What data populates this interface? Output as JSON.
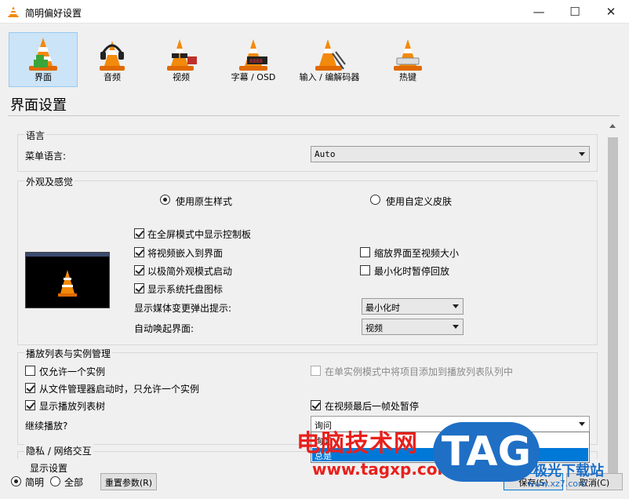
{
  "window": {
    "title": "简明偏好设置",
    "min_glyph": "—",
    "max_glyph": "☐",
    "close_glyph": "✕"
  },
  "categories": [
    {
      "label": "界面",
      "icon": "interface-cone-icon",
      "active": true
    },
    {
      "label": "音频",
      "icon": "audio-headphones-cone-icon",
      "active": false
    },
    {
      "label": "视频",
      "icon": "video-glasses-cone-icon",
      "active": false
    },
    {
      "label": "字幕 / OSD",
      "icon": "subtitle-osd-cone-icon",
      "active": false
    },
    {
      "label": "输入 / 编解码器",
      "icon": "input-codec-cone-icon",
      "active": false
    },
    {
      "label": "热键",
      "icon": "hotkeys-cone-icon",
      "active": false
    }
  ],
  "page_title": "界面设置",
  "language": {
    "group_title": "语言",
    "menu_language_label": "菜单语言:",
    "menu_language_value": "Auto"
  },
  "appearance": {
    "group_title": "外观及感觉",
    "native_style_label": "使用原生样式",
    "custom_skin_label": "使用自定义皮肤",
    "fullscreen_controls_label": "在全屏模式中显示控制板",
    "embed_video_label": "将视频嵌入到界面",
    "minimal_view_label": "以极简外观模式启动",
    "systray_label": "显示系统托盘图标",
    "resize_label": "缩放界面至视频大小",
    "pause_minimized_label": "最小化时暂停回放",
    "media_change_popup_label": "显示媒体变更弹出提示:",
    "media_change_popup_value": "最小化时",
    "auto_raise_label": "自动唤起界面:",
    "auto_raise_value": "视频"
  },
  "playlist": {
    "group_title": "播放列表与实例管理",
    "one_instance_label": "仅允许一个实例",
    "enqueue_label": "在单实例模式中将项目添加到播放列表队列中",
    "file_manager_label": "从文件管理器启动时，只允许一个实例",
    "show_tree_label": "显示播放列表树",
    "pause_last_frame_label": "在视频最后一帧处暂停",
    "continue_label": "继续播放?",
    "continue_value": "询问",
    "continue_options": [
      "询问",
      "总是"
    ]
  },
  "privacy": {
    "group_title": "隐私 / 网络交互"
  },
  "footer": {
    "display_settings_label": "显示设置",
    "simple_label": "简明",
    "all_label": "全部",
    "reset_label": "重置参数(R)",
    "save_label": "保存(S)",
    "cancel_label": "取消(C)"
  },
  "watermark": {
    "cn_text": "电脑技术网",
    "url": "www.tagxp.com",
    "tag": "TAG",
    "site": "极光下载站",
    "url2": "www.xz7.com"
  }
}
